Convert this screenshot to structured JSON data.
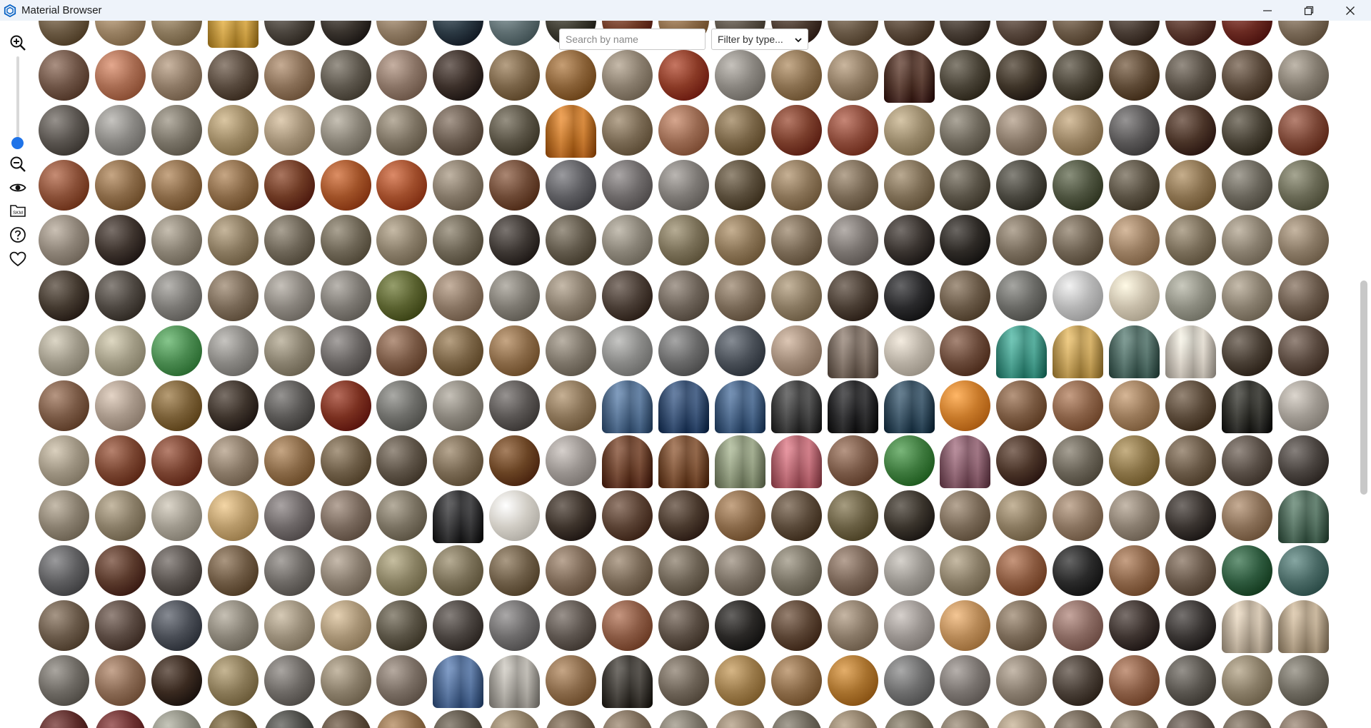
{
  "window": {
    "title": "Material Browser",
    "icon": "sketchup-logo-icon",
    "controls": [
      "minimize-icon",
      "restore-icon",
      "close-icon"
    ]
  },
  "toolbar": {
    "items": [
      "zoom-in-icon",
      "zoom-slider",
      "zoom-out-icon",
      "eye-icon",
      "skm-folder-icon",
      "help-icon",
      "favorites-heart-icon"
    ],
    "skm_label": "SKM",
    "zoom_level": 1.0
  },
  "search": {
    "placeholder": "Search by name",
    "value": ""
  },
  "filter": {
    "selected": "Filter by type..."
  },
  "grid": {
    "columns": 23,
    "visible_rows": 14,
    "partial_top_row": true,
    "partial_bottom_row": true,
    "swatch_colors": [
      [
        "#6b5a44",
        "#9a8264",
        "#8c7a5e",
        "#d4a23c",
        "#4c463f",
        "#3a342e",
        "#8f7b64",
        "#2c3a44",
        "#5f6f72",
        "#3c3a30",
        "#6e3a26",
        "#8a6a48",
        "#5a5248",
        "#4a3a30",
        "#6a5a48",
        "#5a4a3c",
        "#4a4038",
        "#5a4a40",
        "#6b5a48",
        "#4a3e36",
        "#5a3a30",
        "#6a2a22",
        "#7a6a58"
      ],
      [
        "#6e5446",
        "#a86c52",
        "#8e7a66",
        "#584a3e",
        "#8a7058",
        "#5e584e",
        "#8a7466",
        "#3c302a",
        "#7a6448",
        "#8a6238",
        "#8a7e6e",
        "#8a3a26",
        "#8a8680",
        "#8a7050",
        "#8e7a62",
        "#4e2e22",
        "#4a4438",
        "#3e3428",
        "#4a4438",
        "#5e4a36",
        "#5a5248",
        "#5a4a3c",
        "#847c70"
      ],
      [
        "#5a5550",
        "#8a8884",
        "#7a7468",
        "#9e8a66",
        "#a49278",
        "#8a8478",
        "#7e7464",
        "#6a5c50",
        "#5a5446",
        "#c8721e",
        "#7a6a54",
        "#9a6a52",
        "#7a6648",
        "#7a3e2c",
        "#8a4a3a",
        "#9a8a6c",
        "#706a5e",
        "#8a7a6a",
        "#9a8464",
        "#5a5858",
        "#4a3428",
        "#4a4438",
        "#7a4636"
      ],
      [
        "#8a5038",
        "#8a6a48",
        "#8a6a48",
        "#8a6a48",
        "#6e3a24",
        "#a05228",
        "#a04e2c",
        "#847868",
        "#6e4a36",
        "#5e5e62",
        "#6e6a6a",
        "#7e7a76",
        "#5a4e3c",
        "#8a7458",
        "#7a6a56",
        "#7e6e56",
        "#5a5448",
        "#4a4840",
        "#4e5440",
        "#5a5244",
        "#8a7250",
        "#6a665c",
        "#6a6a56"
      ],
      [
        "#8e8478",
        "#3e342e",
        "#8a8274",
        "#8a7a60",
        "#6e6658",
        "#6e6656",
        "#8a7e6a",
        "#6e6656",
        "#3e3834",
        "#625a4c",
        "#8a8478",
        "#7a7058",
        "#8a7456",
        "#7a6a56",
        "#7a7470",
        "#3a3430",
        "#2e2a26",
        "#7a6e5e",
        "#706454",
        "#9a7e62",
        "#7a6e5a",
        "#8a8070",
        "#8a7a66"
      ],
      [
        "#443a30",
        "#4e4842",
        "#7c7a76",
        "#7a6a58",
        "#8a857e",
        "#7e7a74",
        "#5a6230",
        "#8a7664",
        "#7e7a72",
        "#8a7e6e",
        "#4a3e36",
        "#6e645a",
        "#7a6a58",
        "#8a7a62",
        "#4a3e34",
        "#2a2a2c",
        "#6a5a48",
        "#6a6a66",
        "#b6b6b6",
        "#c8beaa",
        "#8e8e82",
        "#8a8070",
        "#6a5a4c"
      ],
      [
        "#a09a8a",
        "#a29c86",
        "#4a8a50",
        "#8a8884",
        "#8a8270",
        "#6a6664",
        "#7a5a46",
        "#7a6446",
        "#8a6a48",
        "#7e766a",
        "#8a8a88",
        "#6a6a6a",
        "#4a5058",
        "#a08a78",
        "#7a6a5e",
        "#b8b0a4",
        "#6a4a3a",
        "#3a9a88",
        "#c8a050",
        "#4a6a62",
        "#d8d0c4",
        "#4a4036",
        "#5a4a40"
      ],
      [
        "#7a5a46",
        "#a8988a",
        "#7a6038",
        "#3e342c",
        "#5a5856",
        "#7a3020",
        "#6e6e6a",
        "#8a857c",
        "#5a5654",
        "#8a7458",
        "#4a6a90",
        "#2e4a72",
        "#3e5e86",
        "#3a3a3a",
        "#1e1e20",
        "#2e4a5e",
        "#c87a2a",
        "#7a5a42",
        "#8a6248",
        "#9a7a5a",
        "#5a4a3a",
        "#2a2a24",
        "#a09a92"
      ],
      [
        "#9e9482",
        "#7a4632",
        "#7a4432",
        "#8a7a68",
        "#8a6a48",
        "#6e5e48",
        "#5e5448",
        "#7a6a54",
        "#6a4424",
        "#9a9490",
        "#6a3a22",
        "#7a4a2a",
        "#8e9a7a",
        "#c06470",
        "#7a5a48",
        "#3e7a3e",
        "#8a5a6a",
        "#4a3428",
        "#6a6458",
        "#8a7448",
        "#6a5a48",
        "#5a5048",
        "#4a4440"
      ],
      [
        "#8a8070",
        "#8a7e68",
        "#a09a8e",
        "#b89a6a",
        "#6e6868",
        "#7a6a5e",
        "#7a7262",
        "#2a2a2c",
        "#d0ccc4",
        "#3e342c",
        "#5a4234",
        "#4a3a2e",
        "#8a6a4a",
        "#5a4a3a",
        "#6a6044",
        "#3a342c",
        "#7a6a58",
        "#8a7a60",
        "#8a7460",
        "#8a7e70",
        "#3a3430",
        "#8a7058",
        "#4a6a58"
      ],
      [
        "#5e5e60",
        "#5a3a2c",
        "#5a5450",
        "#6e5a44",
        "#6e6a66",
        "#8a7e70",
        "#8a8264",
        "#7a7058",
        "#6e5e48",
        "#7e6a58",
        "#7a6a58",
        "#6e6456",
        "#7a7064",
        "#7a7466",
        "#7a6658",
        "#9a9690",
        "#8a7e68",
        "#8a5a40",
        "#2a2a2a",
        "#8a6448",
        "#6a5a4c",
        "#2e5a3e",
        "#4a6a66"
      ],
      [
        "#6a5a4a",
        "#5a4a42",
        "#4a4e56",
        "#8a8478",
        "#9a8e7a",
        "#a89476",
        "#5a5446",
        "#4a4440",
        "#6e6c6c",
        "#5e5650",
        "#8a5a44",
        "#5a4e44",
        "#2a2826",
        "#5a4434",
        "#8a7a68",
        "#9a9490",
        "#b88a58",
        "#7a6a58",
        "#8a6a62",
        "#3e3430",
        "#3a3634",
        "#c8b8a2",
        "#b8a488"
      ],
      [
        "#6e6a64",
        "#8a6a54",
        "#3a2a20",
        "#8a7a58",
        "#6e6a66",
        "#8a7e6a",
        "#7a6e64",
        "#4a6a9a",
        "#aeaaa2",
        "#8a6a4a",
        "#3a3630",
        "#6e6458",
        "#9a7a4a",
        "#8a6a48",
        "#a8722e",
        "#6e6e6e",
        "#7a7470",
        "#8a7e70",
        "#4a4038",
        "#8a5e46",
        "#5a5650",
        "#8a7e68",
        "#6e6a60"
      ],
      [
        "#5a2a28",
        "#6a2e2e",
        "#8a8a7e",
        "#6a5a3a",
        "#4a4a46",
        "#5a4a3a",
        "#8a6a48",
        "#5a5246",
        "#8a7a62",
        "#6a5a48",
        "#7a6a58",
        "#7a7468",
        "#8a7a66",
        "#6a6458",
        "#8a7a64",
        "#6e6656",
        "#7a6e5e",
        "#9a8a74",
        "#6a5e50",
        "#7a6e5e",
        "#5a5048",
        "#6a5e50",
        "#7a6a5c"
      ]
    ],
    "cloth_items": [
      [
        0,
        3
      ],
      [
        2,
        9
      ],
      [
        1,
        15
      ],
      [
        6,
        14
      ],
      [
        6,
        17
      ],
      [
        6,
        18
      ],
      [
        6,
        19
      ],
      [
        6,
        20
      ],
      [
        7,
        10
      ],
      [
        7,
        11
      ],
      [
        7,
        12
      ],
      [
        7,
        13
      ],
      [
        7,
        14
      ],
      [
        7,
        15
      ],
      [
        7,
        21
      ],
      [
        8,
        10
      ],
      [
        8,
        11
      ],
      [
        8,
        12
      ],
      [
        8,
        13
      ],
      [
        8,
        16
      ],
      [
        9,
        7
      ],
      [
        9,
        22
      ],
      [
        11,
        21
      ],
      [
        11,
        22
      ],
      [
        12,
        7
      ],
      [
        12,
        8
      ],
      [
        12,
        10
      ]
    ]
  }
}
